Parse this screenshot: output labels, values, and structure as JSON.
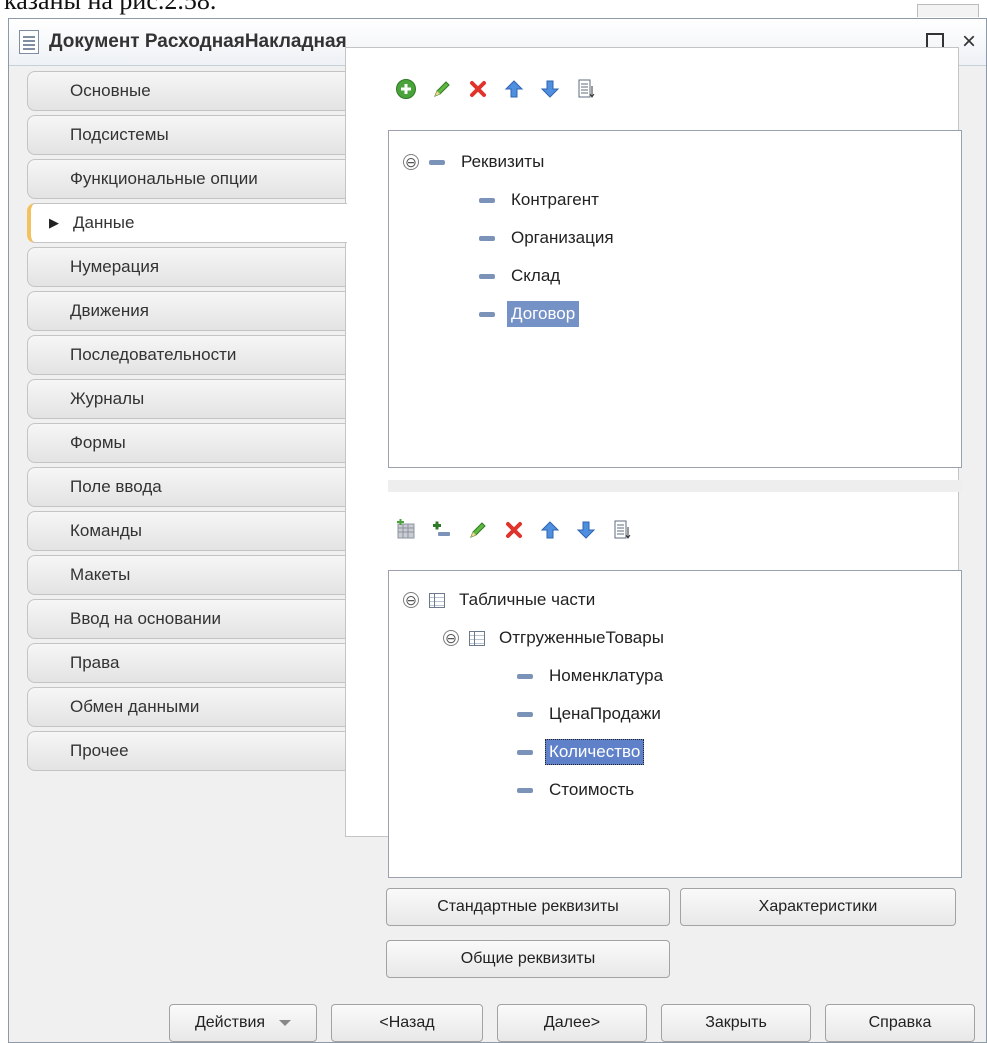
{
  "page_snippet": "казаны на рис.2.58.",
  "window": {
    "title": "Документ РасходнаяНакладная",
    "controls": {
      "minimize": "_",
      "close": "×"
    }
  },
  "tabs": [
    {
      "label": "Основные"
    },
    {
      "label": "Подсистемы"
    },
    {
      "label": "Функциональные опции"
    },
    {
      "label": "Данные",
      "active": true
    },
    {
      "label": "Нумерация"
    },
    {
      "label": "Движения"
    },
    {
      "label": "Последовательности"
    },
    {
      "label": "Журналы"
    },
    {
      "label": "Формы"
    },
    {
      "label": "Поле ввода"
    },
    {
      "label": "Команды"
    },
    {
      "label": "Макеты"
    },
    {
      "label": "Ввод на основании"
    },
    {
      "label": "Права"
    },
    {
      "label": "Обмен данными"
    },
    {
      "label": "Прочее"
    }
  ],
  "tab_active_marker": "▶",
  "attributes_tree": {
    "root": {
      "label": "Реквизиты",
      "toggle": "⊖"
    },
    "items": [
      {
        "label": "Контрагент"
      },
      {
        "label": "Организация"
      },
      {
        "label": "Склад"
      },
      {
        "label": "Договор",
        "selected": true
      }
    ]
  },
  "tabular_tree": {
    "root": {
      "label": "Табличные части",
      "toggle": "⊖"
    },
    "part": {
      "label": "ОтгруженныеТовары",
      "toggle": "⊖"
    },
    "items": [
      {
        "label": "Номенклатура"
      },
      {
        "label": "ЦенаПродажи"
      },
      {
        "label": "Количество",
        "selected": true
      },
      {
        "label": "Стоимость"
      }
    ]
  },
  "content_buttons": {
    "standard": "Стандартные реквизиты",
    "characteristics": "Характеристики",
    "common": "Общие реквизиты"
  },
  "footer_buttons": {
    "actions": "Действия",
    "back": "<Назад",
    "next": "Далее>",
    "close": "Закрыть",
    "help": "Справка"
  },
  "colors": {
    "selection": "#7592c7",
    "active_tab_accent": "#f3c260",
    "add_icon": "#4aa33b",
    "delete_icon": "#e0332b",
    "arrow_icon": "#4f8fe0"
  }
}
